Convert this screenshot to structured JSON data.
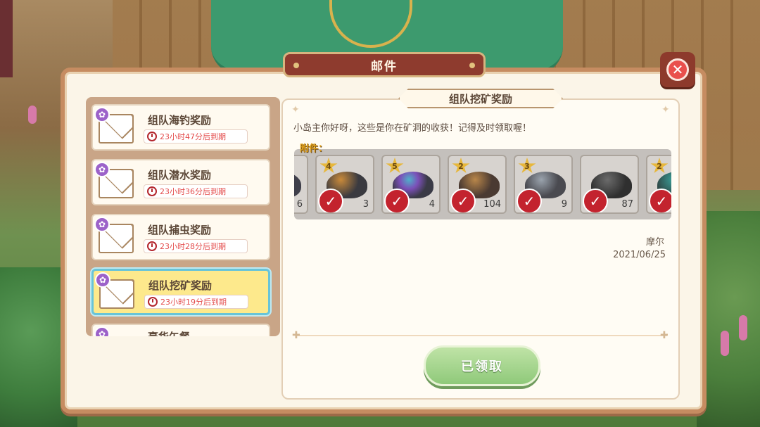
{
  "window": {
    "title": "邮件"
  },
  "mail_list": [
    {
      "title": "组队海钓奖励",
      "expiry": "23小时47分后到期",
      "selected": false
    },
    {
      "title": "组队潜水奖励",
      "expiry": "23小时36分后到期",
      "selected": false
    },
    {
      "title": "组队捕虫奖励",
      "expiry": "23小时28分后到期",
      "selected": false
    },
    {
      "title": "组队挖矿奖励",
      "expiry": "23小时19分后到期",
      "selected": true
    }
  ],
  "partial_item_title": "豪华午餐",
  "detail": {
    "subject": "组队挖矿奖励",
    "body": "小岛主你好呀，这些是你在矿洞的收获！记得及时领取喔！",
    "attachments_label": "附件：",
    "sender": "摩尔",
    "date": "2021/06/25",
    "claim_button_label": "已领取"
  },
  "attachments": [
    {
      "stars": "",
      "quantity": "6",
      "ore_color": "#3f3f4a",
      "claimed": false,
      "partial": "left"
    },
    {
      "stars": "4",
      "quantity": "3",
      "ore_color": "#3a3a40",
      "claimed": true
    },
    {
      "stars": "5",
      "quantity": "4",
      "ore_color": "#3a3a46",
      "claimed": true
    },
    {
      "stars": "2",
      "quantity": "104",
      "ore_color": "#4a3a32",
      "claimed": true
    },
    {
      "stars": "3",
      "quantity": "9",
      "ore_color": "#4a4a50",
      "claimed": true
    },
    {
      "stars": "",
      "quantity": "87",
      "ore_color": "#3c3c3c",
      "claimed": true
    },
    {
      "stars": "2",
      "quantity": "",
      "ore_color": "#2f4a48",
      "claimed": true,
      "partial": "right"
    }
  ],
  "icons": {
    "close": "close-icon",
    "envelope": "envelope-icon",
    "gear": "gear-icon",
    "clock": "alarm-clock-icon",
    "check": "check-icon",
    "star": "star-icon"
  },
  "colors": {
    "title_plate": "#8e3b2e",
    "selected_item": "#fde98c",
    "timer_text": "#e44d4d",
    "claim_button": "#8fc97a",
    "attach_label": "#e2a118"
  }
}
